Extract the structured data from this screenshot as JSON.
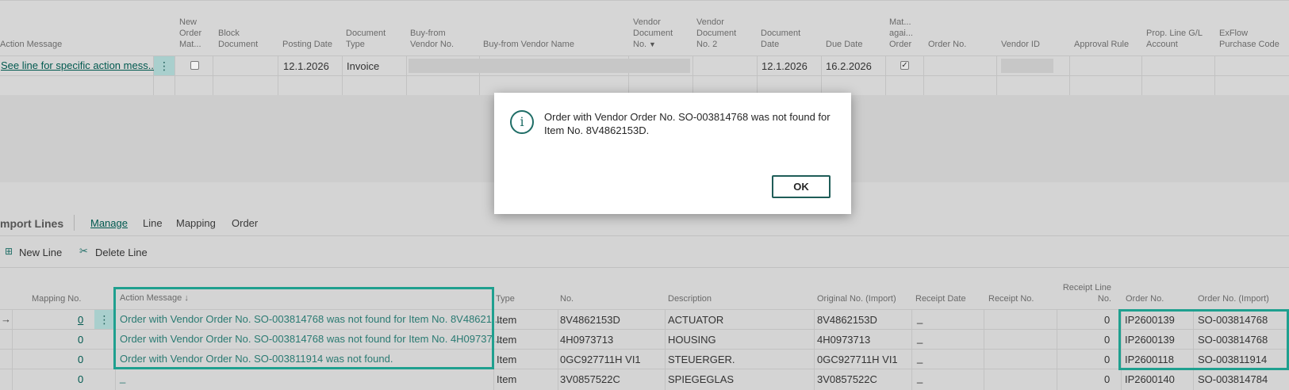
{
  "header": {
    "columns": {
      "action_message": "Action Message",
      "new_order_match": "New\nOrder\nMat...",
      "block_document": "Block\nDocument",
      "posting_date": "Posting Date",
      "document_type": "Document\nType",
      "buy_from_vendor_no": "Buy-from\nVendor No.",
      "buy_from_vendor_name": "Buy-from Vendor Name",
      "vendor_document_no": "Vendor\nDocument\nNo.",
      "vendor_document_no2": "Vendor\nDocument\nNo. 2",
      "document_date": "Document\nDate",
      "due_date": "Due Date",
      "match_against_order": "Mat...\nagai...\nOrder",
      "order_no": "Order No.",
      "vendor_id": "Vendor ID",
      "approval_rule": "Approval Rule",
      "prop_line_account": "Prop. Line G/L\nAccount",
      "exflow_purchase_code": "ExFlow\nPurchase Code"
    },
    "row": {
      "action_message": "See line for specific action mess...",
      "posting_date": "12.1.2026",
      "document_type": "Invoice",
      "document_date": "12.1.2026",
      "due_date": "16.2.2026",
      "new_order_match_checked": false,
      "match_against_order_checked": true
    }
  },
  "tabs": {
    "title": "mport Lines",
    "items": [
      "Manage",
      "Line",
      "Mapping",
      "Order"
    ]
  },
  "actions": {
    "new_line": "New Line",
    "delete_line": "Delete Line"
  },
  "lines": {
    "columns": {
      "mapping_no": "Mapping No.",
      "action_message": "Action Message ↓",
      "type": "Type",
      "no": "No.",
      "description": "Description",
      "original_no": "Original No. (Import)",
      "receipt_date": "Receipt Date",
      "receipt_no": "Receipt No.",
      "receipt_line_no": "Receipt Line\nNo.",
      "order_no": "Order No.",
      "order_no_import": "Order No. (Import)"
    },
    "rows": [
      {
        "mapping_no": "0",
        "action_message": "Order with Vendor Order No. SO-003814768 was not found for Item No. 8V48621...",
        "type": "Item",
        "no": "8V4862153D",
        "description": "ACTUATOR",
        "original_no": "8V4862153D",
        "receipt_date": "_",
        "receipt_line_no": "0",
        "order_no": "IP2600139",
        "order_no_import": "SO-003814768"
      },
      {
        "mapping_no": "0",
        "action_message": "Order with Vendor Order No. SO-003814768 was not found for Item No. 4H09737...",
        "type": "Item",
        "no": "4H0973713",
        "description": "HOUSING",
        "original_no": "4H0973713",
        "receipt_date": "_",
        "receipt_line_no": "0",
        "order_no": "IP2600139",
        "order_no_import": "SO-003814768"
      },
      {
        "mapping_no": "0",
        "action_message": "Order with Vendor Order No. SO-003811914 was not found.",
        "type": "Item",
        "no": "0GC927711H VI1",
        "description": "STEUERGER.",
        "original_no": "0GC927711H VI1",
        "receipt_date": "_",
        "receipt_line_no": "0",
        "order_no": "IP2600118",
        "order_no_import": "SO-003811914"
      },
      {
        "mapping_no": "0",
        "action_message": "_",
        "type": "Item",
        "no": "3V0857522C",
        "description": "SPIEGEGLAS",
        "original_no": "3V0857522C",
        "receipt_date": "_",
        "receipt_line_no": "0",
        "order_no": "IP2600140",
        "order_no_import": "SO-003814784"
      }
    ]
  },
  "dialog": {
    "message": "Order with Vendor Order No. SO-003814768 was not found for Item No. 8V4862153D.",
    "ok_label": "OK",
    "icon": "info-icon"
  },
  "colors": {
    "accent": "#1fa08f",
    "link": "#00594f",
    "selection": "#a9cfcd"
  }
}
